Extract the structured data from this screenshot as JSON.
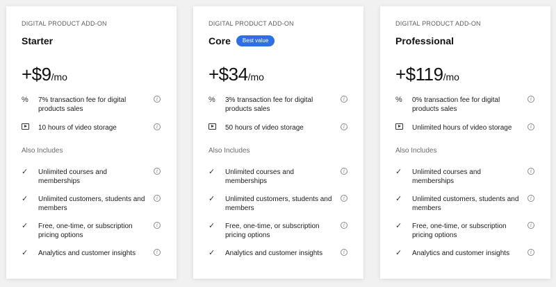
{
  "plans": [
    {
      "eyebrow": "DIGITAL PRODUCT ADD-ON",
      "name": "Starter",
      "badge": "",
      "price": "+$9",
      "period": "/mo",
      "features": [
        {
          "icon": "percent-icon",
          "text": "7% transaction fee for digital products sales"
        },
        {
          "icon": "video-icon",
          "text": "10 hours of video storage"
        }
      ],
      "also_label": "Also Includes",
      "includes": [
        "Unlimited courses and memberships",
        "Unlimited customers, students and members",
        "Free, one-time, or subscription pricing options",
        "Analytics and customer insights"
      ]
    },
    {
      "eyebrow": "DIGITAL PRODUCT ADD-ON",
      "name": "Core",
      "badge": "Best value",
      "price": "+$34",
      "period": "/mo",
      "features": [
        {
          "icon": "percent-icon",
          "text": "3% transaction fee for digital products sales"
        },
        {
          "icon": "video-icon",
          "text": "50 hours of video storage"
        }
      ],
      "also_label": "Also Includes",
      "includes": [
        "Unlimited courses and memberships",
        "Unlimited customers, students and members",
        "Free, one-time, or subscription pricing options",
        "Analytics and customer insights"
      ]
    },
    {
      "eyebrow": "DIGITAL PRODUCT ADD-ON",
      "name": "Professional",
      "badge": "",
      "price": "+$119",
      "period": "/mo",
      "features": [
        {
          "icon": "percent-icon",
          "text": "0% transaction fee for digital products sales"
        },
        {
          "icon": "video-icon",
          "text": "Unlimited hours of video storage"
        }
      ],
      "also_label": "Also Includes",
      "includes": [
        "Unlimited courses and memberships",
        "Unlimited customers, students and members",
        "Free, one-time, or subscription pricing options",
        "Analytics and customer insights"
      ]
    }
  ],
  "colors": {
    "badge_bg": "#2e6fe6",
    "card_bg": "#ffffff",
    "page_bg": "#f1f1f1"
  },
  "icons": {
    "percent": "%",
    "check": "✓",
    "info": "i"
  }
}
